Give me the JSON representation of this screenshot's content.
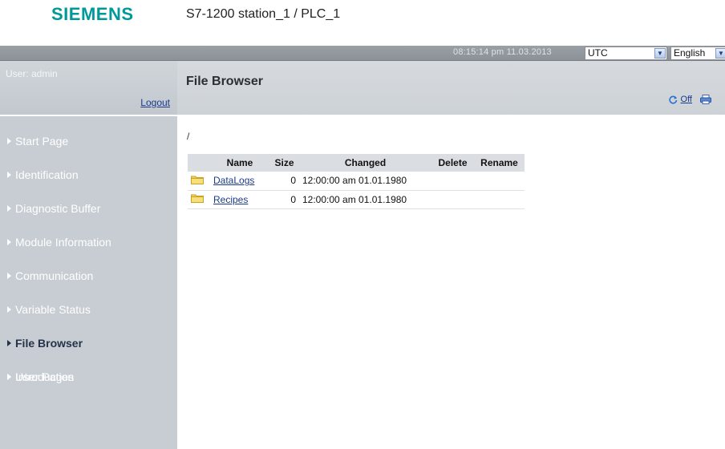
{
  "header": {
    "logo": "SIEMENS",
    "station": "S7-1200 station_1 / PLC_1"
  },
  "topbar": {
    "clock": "08:15:14 pm  11.03.2013",
    "timezone": "UTC",
    "language": "English"
  },
  "sidebar": {
    "user": "User: admin",
    "logout": "Logout",
    "items": [
      {
        "label": "Start Page"
      },
      {
        "label": "Identification"
      },
      {
        "label": "Diagnostic Buffer"
      },
      {
        "label": "Module Information"
      },
      {
        "label": "Communication"
      },
      {
        "label": "Variable Status"
      },
      {
        "label": "File Browser",
        "active": true
      },
      {
        "label": "User Pages"
      }
    ],
    "intro": "Introduction"
  },
  "content": {
    "title": "File Browser",
    "refresh_label": "Off",
    "path": "/",
    "columns": [
      "",
      "Name",
      "Size",
      "Changed",
      "Delete",
      "Rename"
    ],
    "rows": [
      {
        "name": "DataLogs",
        "size": "0",
        "changed": "12:00:00 am 01.01.1980"
      },
      {
        "name": "Recipes",
        "size": "0",
        "changed": "12:00:00 am 01.01.1980"
      }
    ]
  },
  "colors": {
    "brand": "#009999",
    "sidebar": "#c7cdd3",
    "topbar": "#8b9197",
    "link": "#1a3a8a"
  }
}
